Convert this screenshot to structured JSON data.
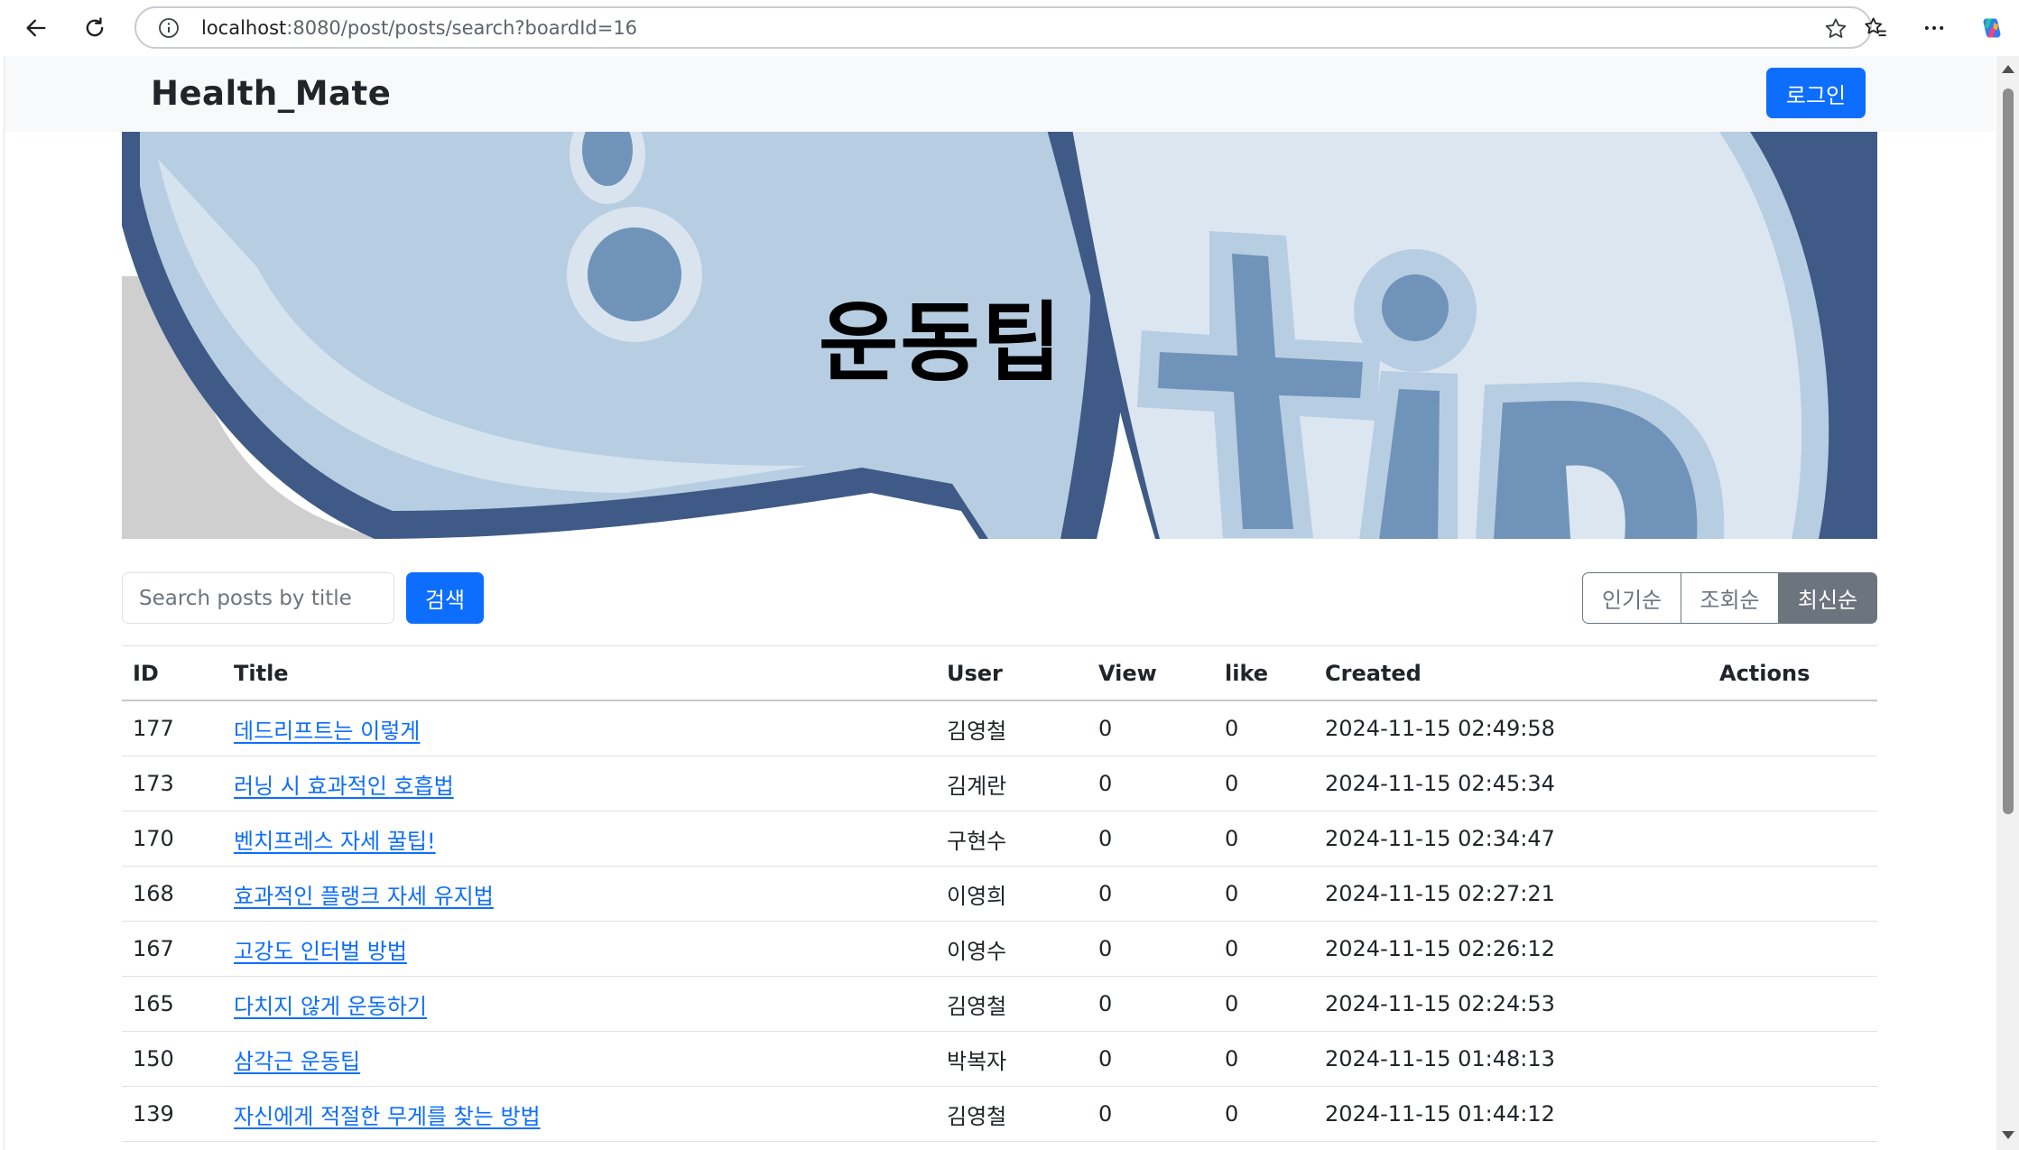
{
  "browser": {
    "url_host": "localhost",
    "url_rest": ":8080/post/posts/search?boardId=16"
  },
  "navbar": {
    "brand": "Health_Mate",
    "login_label": "로그인"
  },
  "banner": {
    "title": "운동팁",
    "art_text": "tip"
  },
  "search": {
    "placeholder": "Search posts by title",
    "button_label": "검색"
  },
  "sort": {
    "options": [
      "인기순",
      "조회순",
      "최신순"
    ],
    "selected": "최신순"
  },
  "table": {
    "headers": {
      "id": "ID",
      "title": "Title",
      "user": "User",
      "view": "View",
      "like": "like",
      "created": "Created",
      "actions": "Actions"
    },
    "rows": [
      {
        "id": "177",
        "title": "데드리프트는 이렇게",
        "user": "김영철",
        "view": "0",
        "like": "0",
        "created": "2024-11-15 02:49:58"
      },
      {
        "id": "173",
        "title": "러닝 시 효과적인 호흡법",
        "user": "김계란",
        "view": "0",
        "like": "0",
        "created": "2024-11-15 02:45:34"
      },
      {
        "id": "170",
        "title": "벤치프레스 자세 꿀팁!",
        "user": "구현수",
        "view": "0",
        "like": "0",
        "created": "2024-11-15 02:34:47"
      },
      {
        "id": "168",
        "title": "효과적인 플랭크 자세 유지법",
        "user": "이영희",
        "view": "0",
        "like": "0",
        "created": "2024-11-15 02:27:21"
      },
      {
        "id": "167",
        "title": "고강도 인터벌 방법",
        "user": "이영수",
        "view": "0",
        "like": "0",
        "created": "2024-11-15 02:26:12"
      },
      {
        "id": "165",
        "title": "다치지 않게 운동하기",
        "user": "김영철",
        "view": "0",
        "like": "0",
        "created": "2024-11-15 02:24:53"
      },
      {
        "id": "150",
        "title": "삼각근 운동팁",
        "user": "박복자",
        "view": "0",
        "like": "0",
        "created": "2024-11-15 01:48:13"
      },
      {
        "id": "139",
        "title": "자신에게 적절한 무게를 찾는 방법",
        "user": "김영철",
        "view": "0",
        "like": "0",
        "created": "2024-11-15 01:44:12"
      }
    ]
  },
  "colors": {
    "primary": "#0d6efd",
    "secondary": "#6c757d",
    "navbar_bg": "#f8f9fa",
    "banner_dark": "#3f5a86",
    "banner_mid": "#7093b9",
    "banner_light": "#b7cde2"
  }
}
